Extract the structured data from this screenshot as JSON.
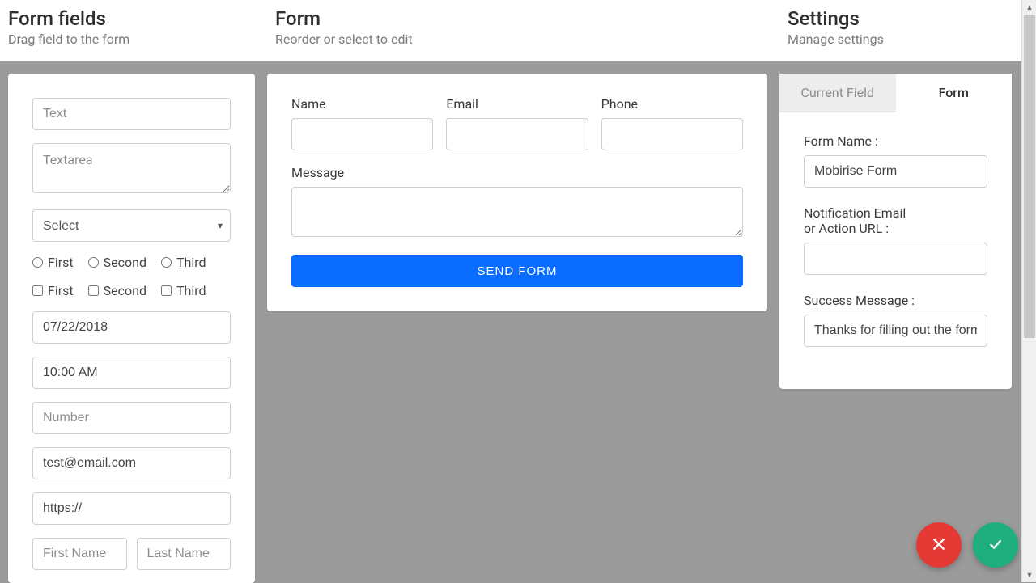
{
  "header": {
    "left": {
      "title": "Form fields",
      "sub": "Drag field to the form"
    },
    "mid": {
      "title": "Form",
      "sub": "Reorder or select to edit"
    },
    "right": {
      "title": "Settings",
      "sub": "Manage settings"
    }
  },
  "palette": {
    "text_placeholder": "Text",
    "textarea_placeholder": "Textarea",
    "select_placeholder": "Select",
    "radios": [
      "First",
      "Second",
      "Third"
    ],
    "checks": [
      "First",
      "Second",
      "Third"
    ],
    "date_value": "07/22/2018",
    "time_value": "10:00 AM",
    "number_placeholder": "Number",
    "email_value": "test@email.com",
    "url_value": "https://",
    "first_name_placeholder": "First Name",
    "last_name_placeholder": "Last Name"
  },
  "form": {
    "name_label": "Name",
    "email_label": "Email",
    "phone_label": "Phone",
    "message_label": "Message",
    "submit_label": "SEND FORM"
  },
  "settings": {
    "tabs": {
      "current_field": "Current Field",
      "form": "Form"
    },
    "form_name_label": "Form Name :",
    "form_name_value": "Mobirise Form",
    "notification_label_l1": "Notification Email",
    "notification_label_l2": "or Action URL :",
    "notification_value": "",
    "success_label": "Success Message :",
    "success_value": "Thanks for filling out the form!"
  }
}
